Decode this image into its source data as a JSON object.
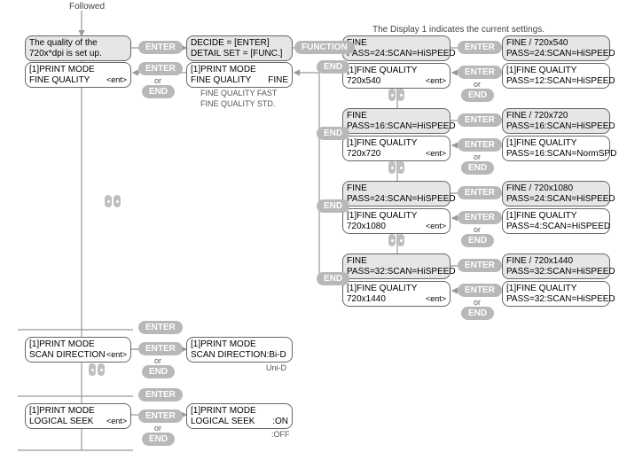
{
  "header": {
    "followed": "Followed",
    "display1_note": "The Display 1 indicates the current settings."
  },
  "pill_labels": {
    "enter": "ENTER",
    "end": "END",
    "function": "FUNCTION"
  },
  "misc": {
    "or": "or",
    "ent": "<ent>",
    "uni_d": "Uni-D",
    "off": ":OFF",
    "fq_fast": "FINE QUALITY  FAST",
    "fq_std": "FINE QUALITY  STD."
  },
  "col1": {
    "setup": {
      "l1": "The quality of the",
      "l2": "720x*dpi is set up."
    },
    "pm_fine": {
      "l1": "[1]PRINT MODE",
      "l2": "FINE QUALITY"
    },
    "pm_scan_dir": {
      "l1": "[1]PRINT MODE",
      "l2": "SCAN DIRECTION"
    },
    "pm_logical": {
      "l1": "[1]PRINT MODE",
      "l2": "LOGICAL SEEK"
    }
  },
  "col2": {
    "decide": {
      "l1": "DECIDE      = [ENTER]",
      "l2": "DETAIL SET  = [FUNC.]"
    },
    "pm_fine_fine": {
      "l1": "[1]PRINT MODE",
      "l2": "FINE QUALITY",
      "r2": "FINE"
    },
    "pm_scan_bid": {
      "l1": "[1]PRINT MODE",
      "l2": "SCAN DIRECTION:Bi-D"
    },
    "pm_logical_on": {
      "l1": "[1]PRINT MODE",
      "l2": "LOGICAL SEEK",
      "r2": ":ON"
    }
  },
  "col3": {
    "g1": {
      "top": {
        "l1": "FINE",
        "l2": "PASS=24:SCAN=HiSPEED"
      },
      "bot": {
        "l1": "[1]FINE QUALITY",
        "l2": "720x540"
      }
    },
    "g2": {
      "top": {
        "l1": "FINE",
        "l2": "PASS=16:SCAN=HiSPEED"
      },
      "bot": {
        "l1": "[1]FINE QUALITY",
        "l2": "720x720"
      }
    },
    "g3": {
      "top": {
        "l1": "FINE",
        "l2": "PASS=24:SCAN=HiSPEED"
      },
      "bot": {
        "l1": "[1]FINE QUALITY",
        "l2": "720x1080"
      }
    },
    "g4": {
      "top": {
        "l1": "FINE",
        "l2": "PASS=32:SCAN=HiSPEED"
      },
      "bot": {
        "l1": "[1]FINE QUALITY",
        "l2": "720x1440"
      }
    }
  },
  "col4": {
    "g1": {
      "top": {
        "l1": "FINE / 720x540",
        "l2": "PASS=24:SCAN=HiSPEED"
      },
      "bot": {
        "l1": "[1]FINE QUALITY",
        "l2": "PASS=12:SCAN=HiSPEED"
      }
    },
    "g2": {
      "top": {
        "l1": "FINE / 720x720",
        "l2": "PASS=16:SCAN=HiSPEED"
      },
      "bot": {
        "l1": "[1]FINE QUALITY",
        "l2": "PASS=16:SCAN=NormSPD"
      }
    },
    "g3": {
      "top": {
        "l1": "FINE / 720x1080",
        "l2": "PASS=24:SCAN=HiSPEED"
      },
      "bot": {
        "l1": "[1]FINE QUALITY",
        "l2": "PASS=4:SCAN=HiSPEED"
      }
    },
    "g4": {
      "top": {
        "l1": "FINE / 720x1440",
        "l2": "PASS=32:SCAN=HiSPEED"
      },
      "bot": {
        "l1": "[1]FINE QUALITY",
        "l2": "PASS=32:SCAN=HiSPEED"
      }
    }
  }
}
